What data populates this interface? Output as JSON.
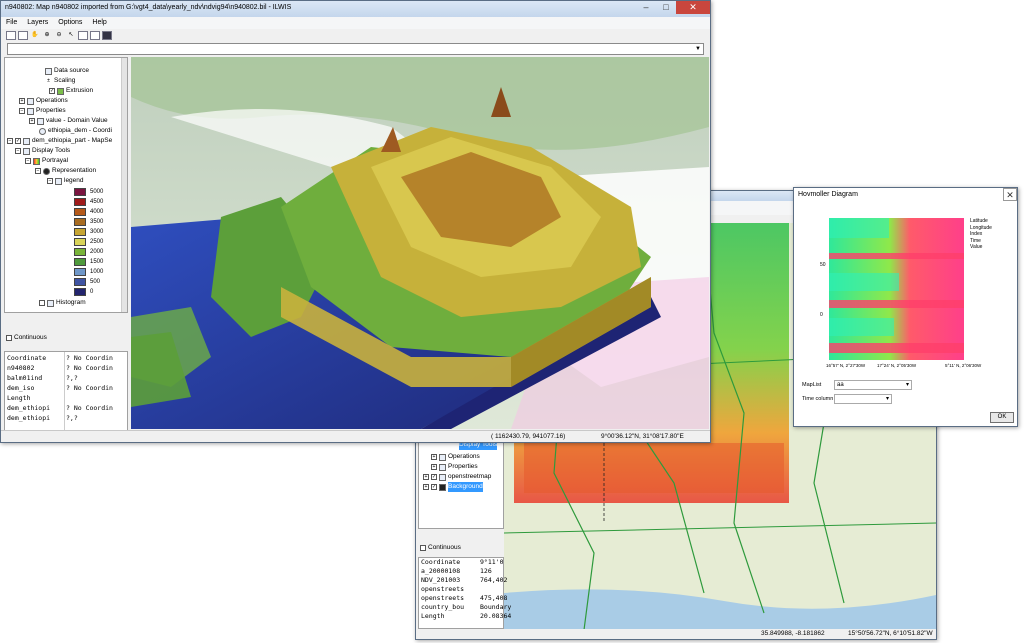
{
  "main_window": {
    "title": "n940802: Map n940802 imported from G:\\vgt4_data\\yearly_ndv\\ndvig94\\n940802.bil - ILWIS",
    "menu": [
      "File",
      "Layers",
      "Options",
      "Help"
    ],
    "tree": {
      "data_source": "Data source",
      "scaling": "Scaling",
      "extrusion": "Extrusion",
      "operations": "Operations",
      "properties": "Properties",
      "value_domain": "value - Domain Value",
      "ethiopia_coord": "ethiopia_dem - Coordi",
      "dem_part": "dem_ethiopia_part - MapSe",
      "display_tools": "Display Tools",
      "portrayal": "Portrayal",
      "representation": "Representation",
      "legend": "legend",
      "histogram": "Histogram"
    },
    "legend": {
      "values": [
        "5000",
        "4500",
        "4000",
        "3500",
        "3000",
        "2500",
        "2000",
        "1500",
        "1000",
        "500",
        "0"
      ],
      "colors": [
        "#7a1540",
        "#a01c1c",
        "#b55a1a",
        "#a86c22",
        "#c6a533",
        "#d9d45a",
        "#79b43a",
        "#4f9a3c",
        "#6f97c8",
        "#3f54a3",
        "#23256e"
      ]
    },
    "continuous_label": "Continuous",
    "pixel_info": [
      {
        "key": "Coordinate",
        "value": "? No Coordin"
      },
      {
        "key": "n940802",
        "value": "? No Coordin"
      },
      {
        "key": "balm01ind",
        "value": "?,?"
      },
      {
        "key": "dem_iso",
        "value": "? No Coordin"
      },
      {
        "key": "Length",
        "value": ""
      },
      {
        "key": "dem_ethiopi",
        "value": "? No Coordin"
      },
      {
        "key": "dem_ethiopi",
        "value": "?,?"
      }
    ],
    "status_xy": "( 1162430.79,   941077.16)",
    "status_latlon": "9°00'36.12\"N, 31°08'17.80\"E"
  },
  "second_window": {
    "tree": {
      "item_top": "Display Tools",
      "operations": "Operations",
      "properties": "Properties",
      "openstreetmap": "openstreetmap",
      "background": "Background"
    },
    "continuous_label": "Continuous",
    "pixel_info": [
      {
        "key": "Coordinate",
        "value": "9°11'0"
      },
      {
        "key": "a_20000108",
        "value": "126"
      },
      {
        "key": "NDV_201003",
        "value": "764,402"
      },
      {
        "key": "openstreets",
        "value": ""
      },
      {
        "key": "openstreets",
        "value": "475,408"
      },
      {
        "key": "country_bou",
        "value": "Boundary"
      },
      {
        "key": "Length",
        "value": "20.08364"
      }
    ],
    "status_xy": "35.849988, -8.181862",
    "status_latlon": "15°50'56.72\"N, 6°10'51.82\"W"
  },
  "hovmoller": {
    "title": "Hovmoller Diagram",
    "side_labels": [
      "Latitude",
      "Longitude",
      "Index",
      "Time",
      "Value"
    ],
    "y_ticks": [
      "50",
      "0"
    ],
    "x_ticks": [
      "16°57' N,  2°27'30W",
      "17°24' N,  2°05'30W",
      "5°11' N,  2°06'30W"
    ],
    "maplist_label": "MapList",
    "maplist_value": "aa",
    "time_column_label": "Time column",
    "ok_label": "OK"
  }
}
